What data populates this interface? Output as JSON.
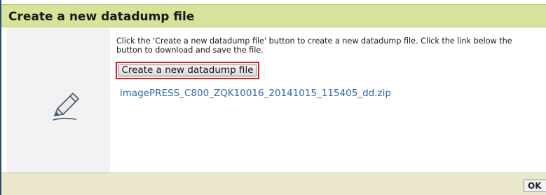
{
  "dialog": {
    "title": "Create a new datadump file",
    "instructions": "Click the 'Create a new datadump file' button to create a new datadump file. Click the link below the button to download and save the file.",
    "create_button_label": "Create a new datadump file",
    "file_link": "imagePRESS_C800_ZQK10016_20141015_115405_dd.zip",
    "ok_label": "OK"
  },
  "colors": {
    "title_bar": "#d7e39a",
    "highlight_border": "#cc1f2a",
    "link": "#3366aa",
    "footer": "#ebe8cc"
  },
  "icons": {
    "left_pane": "pencil-icon"
  }
}
